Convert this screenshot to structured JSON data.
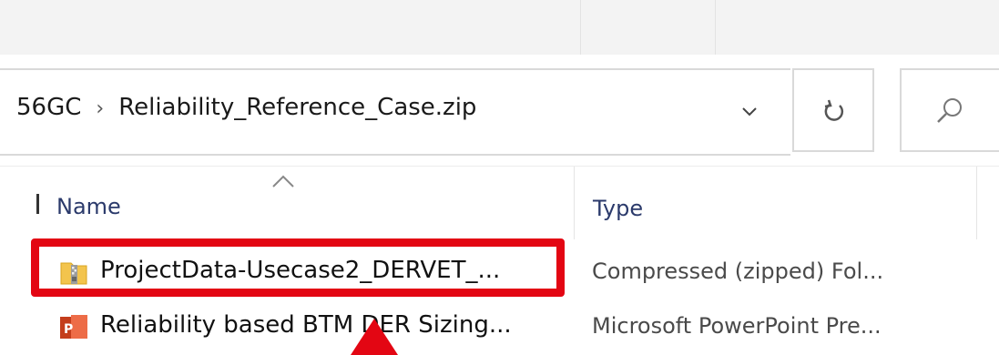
{
  "address": {
    "crumb_prev": "56GC",
    "separator": "›",
    "current": "Reliability_Reference_Case.zip",
    "dropdown_glyph": "⌄",
    "refresh_icon": "refresh-icon",
    "search_icon": "search-icon"
  },
  "columns": {
    "name": "Name",
    "type": "Type"
  },
  "files": [
    {
      "name": "ProjectData-Usecase2_DERVET_...",
      "type": "Compressed (zipped) Fol...",
      "icon": "zip-folder-icon"
    },
    {
      "name": "Reliability based BTM DER Sizing...",
      "type": "Microsoft PowerPoint Pre...",
      "icon": "powerpoint-icon"
    }
  ],
  "colors": {
    "highlight": "#e30613",
    "header_text": "#2b3a6b"
  }
}
